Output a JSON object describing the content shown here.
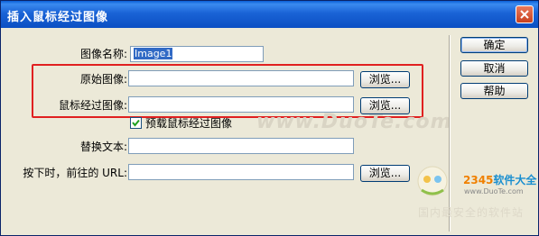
{
  "window": {
    "title": "插入鼠标经过图像",
    "close_icon": "close-icon"
  },
  "form": {
    "image_name": {
      "label": "图像名称:",
      "value": "Image1"
    },
    "original_image": {
      "label": "原始图像:",
      "value": "",
      "browse": "浏览..."
    },
    "rollover_image": {
      "label": "鼠标经过图像:",
      "value": "",
      "browse": "浏览..."
    },
    "preload": {
      "label": "预载鼠标经过图像",
      "checked": true
    },
    "alt_text": {
      "label": "替换文本:",
      "value": ""
    },
    "url": {
      "label": "按下时，前往的 URL:",
      "value": "",
      "browse": "浏览..."
    }
  },
  "buttons": {
    "ok": "确定",
    "cancel": "取消",
    "help": "帮助"
  },
  "watermark": {
    "site": "www.DuoTe.com",
    "brand_prefix": "2345",
    "brand_suffix": "软件大全",
    "brand_url": "www.DuoTe.com",
    "slogan": "国内最安全的软件站"
  },
  "colors": {
    "highlight": "#e02020",
    "titlebar": "#0b4fc3",
    "selection": "#316ac5"
  }
}
